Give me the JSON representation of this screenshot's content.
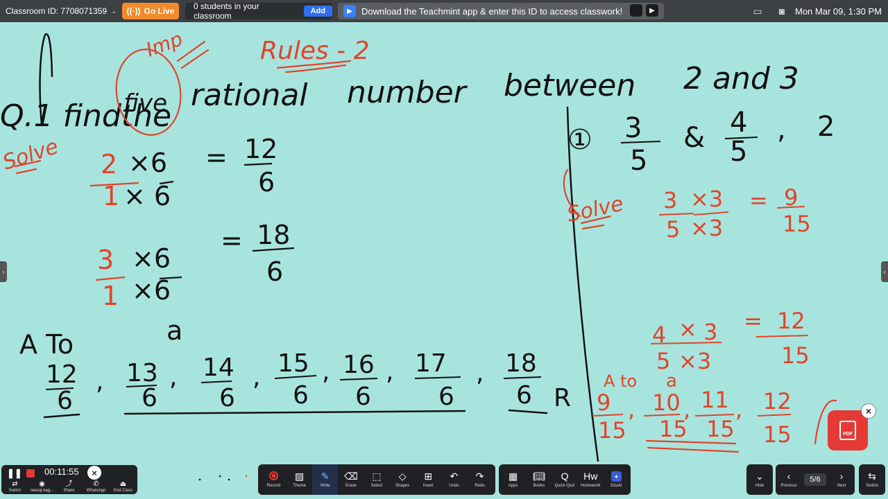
{
  "topbar": {
    "classroom_id": "Classroom ID: 7708071359",
    "go_live": "Go Live",
    "students_text": "0 students in your classroom",
    "add_label": "Add",
    "download_text": "Download the Teachmint app & enter this ID to access classwork!",
    "datetime": "Mon Mar 09, 1:30 PM"
  },
  "board": {
    "question": "Q.1 find the five rational number between 2 and 3",
    "imp_note": "Imp",
    "rules_note": "Rules - 2",
    "solve_left": "Solve",
    "eq1_lhs_top": "2 ×6",
    "eq1_lhs_bottom": "1 ×6",
    "eq1_rhs_top": "12",
    "eq1_rhs_bottom": "6",
    "eq2_lhs_top": "3 ×6",
    "eq2_lhs_bottom": "1 ×6",
    "eq2_rhs_top": "18",
    "eq2_rhs_bottom": "6",
    "a_to_a": "A To a",
    "sequence": [
      {
        "n": "12",
        "d": "6"
      },
      {
        "n": "13",
        "d": "6"
      },
      {
        "n": "14",
        "d": "6"
      },
      {
        "n": "15",
        "d": "6"
      },
      {
        "n": "16",
        "d": "6"
      },
      {
        "n": "17",
        "d": "6"
      },
      {
        "n": "18",
        "d": "6"
      }
    ],
    "sequence_end": "R",
    "right_problem": "(1) 3/5 & 4/5 , 2",
    "solve_right": "Solve",
    "r_eq1_top": "3 ×3",
    "r_eq1_bottom": "5 ×3",
    "r_eq1_rhs_top": "9",
    "r_eq1_rhs_bottom": "15",
    "r_eq2_top": "4 ×3",
    "r_eq2_bottom": "5 ×3",
    "r_eq2_rhs_top": "12",
    "r_eq2_rhs_bottom": "15",
    "r_a_to_a": "A to a",
    "r_sequence": [
      {
        "n": "9",
        "d": "15"
      },
      {
        "n": "10",
        "d": "15"
      },
      {
        "n": "11",
        "d": "15"
      },
      {
        "n": "12",
        "d": "15"
      }
    ]
  },
  "recorder": {
    "timer": "00:11:55",
    "tools": [
      "Switch",
      "neeraj bag...",
      "Share",
      "WhatsApp",
      "End Class"
    ]
  },
  "toolbar": {
    "tools": [
      "Record",
      "Theme",
      "Write",
      "Erase",
      "Select",
      "Shapes",
      "Insert",
      "Undo",
      "Redo"
    ],
    "apps": [
      "Apps",
      "Books",
      "Quick Quiz",
      "Homework",
      "EduAI"
    ],
    "hide": "Hide",
    "previous": "Previous",
    "next": "Next",
    "page": "5/6",
    "switch": "Switch",
    "pdf_label": "PDF"
  },
  "colors": {
    "board_bg": "#a8e4de",
    "ink_black": "#111111",
    "ink_red": "#e0442a",
    "accent": "#2f6fed",
    "live_orange": "#f28b2e"
  }
}
